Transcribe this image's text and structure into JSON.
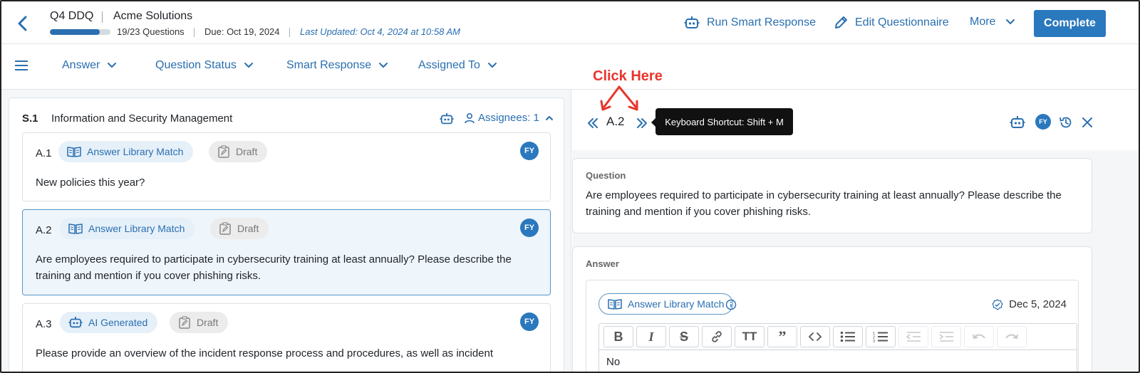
{
  "header": {
    "title": "Q4 DDQ",
    "company": "Acme Solutions",
    "progress_fraction": 0.82,
    "questions_count": "19/23 Questions",
    "due": "Due: Oct 19, 2024",
    "last_updated": "Last Updated: Oct 4, 2024 at 10:58 AM",
    "run_smart_response": "Run Smart Response",
    "edit_questionnaire": "Edit Questionnaire",
    "more": "More",
    "complete": "Complete"
  },
  "filters": [
    {
      "label": "Answer"
    },
    {
      "label": "Question Status"
    },
    {
      "label": "Smart Response"
    },
    {
      "label": "Assigned To"
    }
  ],
  "section": {
    "number": "S.1",
    "title": "Information and Security Management",
    "assignees": "Assignees: 1"
  },
  "questions": [
    {
      "id": "A.1",
      "source": "Answer Library Match",
      "status": "Draft",
      "assignee": "FY",
      "text": "New policies this year?"
    },
    {
      "id": "A.2",
      "source": "Answer Library Match",
      "status": "Draft",
      "assignee": "FY",
      "text": "Are employees required to participate in cybersecurity training at least annually? Please describe the training and mention if you cover phishing risks."
    },
    {
      "id": "A.3",
      "source": "AI Generated",
      "status": "Draft",
      "assignee": "FY",
      "text": "Please provide an overview of the incident response process and procedures, as well as incident"
    }
  ],
  "detail": {
    "current_question": "A.2",
    "tooltip": "Keyboard Shortcut: Shift + M",
    "assignee": "FY",
    "question_label": "Question",
    "question_text": "Are employees required to participate in cybersecurity training at least annually? Please describe the training and mention if you cover phishing risks.",
    "answer_label": "Answer",
    "answer_source": "Answer Library Match",
    "answer_date": "Dec 5, 2024",
    "answer_text": "No"
  },
  "annotation": {
    "text": "Click Here",
    "color": "#e8352b"
  },
  "colors": {
    "accent": "#2a78bd",
    "link": "#2a6fb0"
  }
}
